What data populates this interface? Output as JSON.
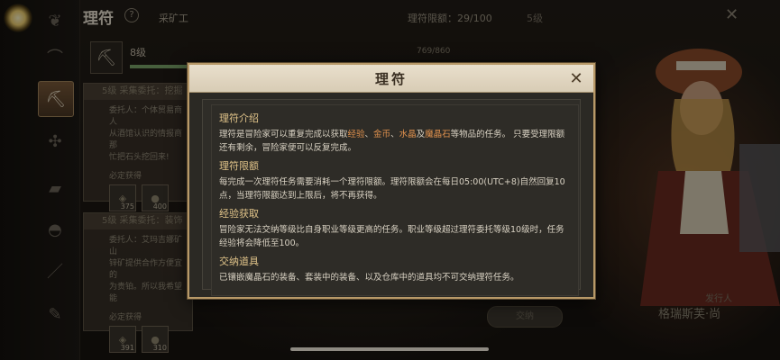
{
  "header": {
    "title": "理符",
    "help": "?",
    "job_name": "采矿工",
    "limit_text": "理符限额：29/100",
    "level_text": "5级"
  },
  "job": {
    "level": "8级",
    "exp_text": "769/860",
    "exp_fraction": 0.89
  },
  "cards": [
    {
      "head": "5级 采集委托：挖掘",
      "body": "委托人：个体贸易商人\n从酒馆认识的情报商那\n忙把石头挖回来!",
      "req": "必定获得",
      "rewards": [
        "375",
        "400"
      ]
    },
    {
      "head": "5级 采集委托：装饰",
      "body": "委托人：艾玛吉娜矿山\n锌矿提供合作方便宜的\n为贵铂。所以我希望能",
      "req": "必定获得",
      "rewards": [
        "391",
        "310"
      ]
    }
  ],
  "npc": {
    "role": "发行人",
    "name": "格瑞斯芙·尚"
  },
  "accept_label": "交纳",
  "modal": {
    "title": "理符",
    "close_icon": "close-icon",
    "sections": [
      {
        "title": "理符介绍",
        "parts": [
          {
            "t": "理符是冒险家可以重复完成以获取",
            "hl": false
          },
          {
            "t": "经验",
            "hl": true
          },
          {
            "t": "、",
            "hl": false
          },
          {
            "t": "金币",
            "hl": true
          },
          {
            "t": "、",
            "hl": false
          },
          {
            "t": "水晶",
            "hl": true
          },
          {
            "t": "及",
            "hl": false
          },
          {
            "t": "魔晶石",
            "hl": true
          },
          {
            "t": "等物品的任务。 只要受理限额还有剩余，冒险家便可以反复完成。",
            "hl": false
          }
        ]
      },
      {
        "title": "理符限额",
        "parts": [
          {
            "t": "每完成一次理符任务需要消耗一个理符限额。理符限额会在每日05:00(UTC+8)自然回复10点，当理符限额达到上限后，将不再获得。",
            "hl": false
          }
        ]
      },
      {
        "title": "经验获取",
        "parts": [
          {
            "t": "冒险家无法交纳等级比自身职业等级更高的任务。职业等级超过理符委托等级10级时，任务经验将会降低至100。",
            "hl": false
          }
        ]
      },
      {
        "title": "交纳道具",
        "parts": [
          {
            "t": "已镶嵌魔晶石的装备、套装中的装备、以及仓库中的道具均不可交纳理符任务。",
            "hl": false
          }
        ]
      }
    ]
  },
  "colors": {
    "accent": "#b89968",
    "highlight": "#e2924e",
    "section_title": "#e1c48a"
  }
}
